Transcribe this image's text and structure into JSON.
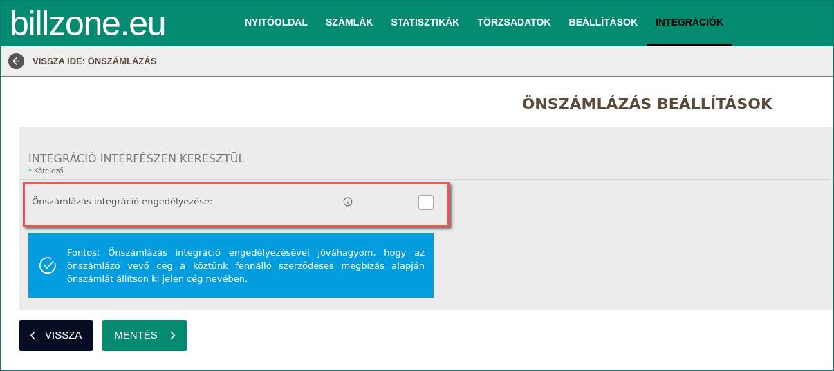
{
  "logo": "billzone.eu",
  "nav": [
    {
      "label": "NYITÓOLDAL",
      "selected": false
    },
    {
      "label": "SZÁMLÁK",
      "selected": false
    },
    {
      "label": "STATISZTIKÁK",
      "selected": false
    },
    {
      "label": "TÖRZSADATOK",
      "selected": false
    },
    {
      "label": "BEÁLLÍTÁSOK",
      "selected": false
    },
    {
      "label": "INTEGRÁCIÓK",
      "selected": true
    }
  ],
  "back_link": "VISSZA IDE: ÖNSZÁMLÁZÁS",
  "page_title": "ÖNSZÁMLÁZÁS BEÁLLÍTÁSOK",
  "section": {
    "title": "INTEGRÁCIÓ INTERFÉSZEN KERESZTÜL",
    "required_mark": "*",
    "required_note": "Kötelező"
  },
  "field": {
    "label": "Önszámlázás integráció engedélyezése:",
    "checked": false,
    "highlighted": true
  },
  "notice": "Fontos: Önszámlázás integráció engedélyezésével jóváhagyom, hogy az önszámlázó vevő cég a köztünk fennálló szerződéses megbízás alapján önszámlát állítson ki jelen cég nevében.",
  "buttons": [
    {
      "label": "VISSZA",
      "kind": "back"
    },
    {
      "label": "MENTÉS",
      "kind": "save"
    }
  ]
}
